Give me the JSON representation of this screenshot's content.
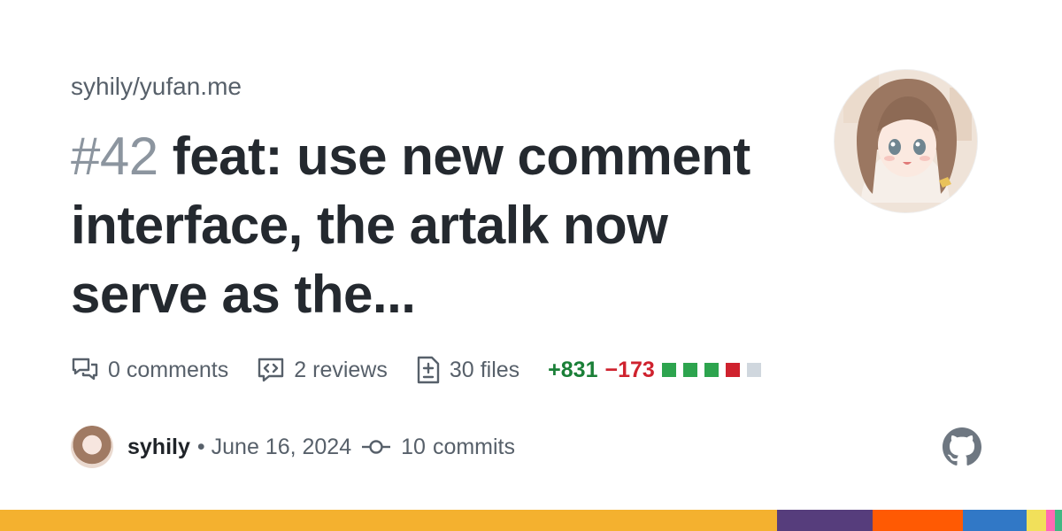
{
  "repo": "syhily/yufan.me",
  "pr": {
    "number": "#42",
    "title": "feat: use new comment interface, the artalk now serve as the..."
  },
  "stats": {
    "comments_count": "0",
    "comments_label": "comments",
    "reviews_count": "2",
    "reviews_label": "reviews",
    "files_count": "30",
    "files_label": "files",
    "additions": "+831",
    "deletions": "−173",
    "diff_squares": [
      "#2da44e",
      "#2da44e",
      "#2da44e",
      "#cf222e",
      "#d0d7de"
    ]
  },
  "meta": {
    "author": "syhily",
    "separator": "•",
    "date": "June 16, 2024",
    "commits_count": "10",
    "commits_label": "commits"
  },
  "language_bar": [
    {
      "color": "#f4b12f",
      "fraction": 0.732
    },
    {
      "color": "#563d7c",
      "fraction": 0.09
    },
    {
      "color": "#ff5a03",
      "fraction": 0.085
    },
    {
      "color": "#3178c6",
      "fraction": 0.06
    },
    {
      "color": "#f1e05a",
      "fraction": 0.018
    },
    {
      "color": "#ff69b4",
      "fraction": 0.008
    },
    {
      "color": "#41b883",
      "fraction": 0.007
    }
  ],
  "colors": {
    "text": "#24292f",
    "muted": "#57606a",
    "number": "#8c959f",
    "additions": "#1a7f37",
    "deletions": "#cf222e"
  }
}
